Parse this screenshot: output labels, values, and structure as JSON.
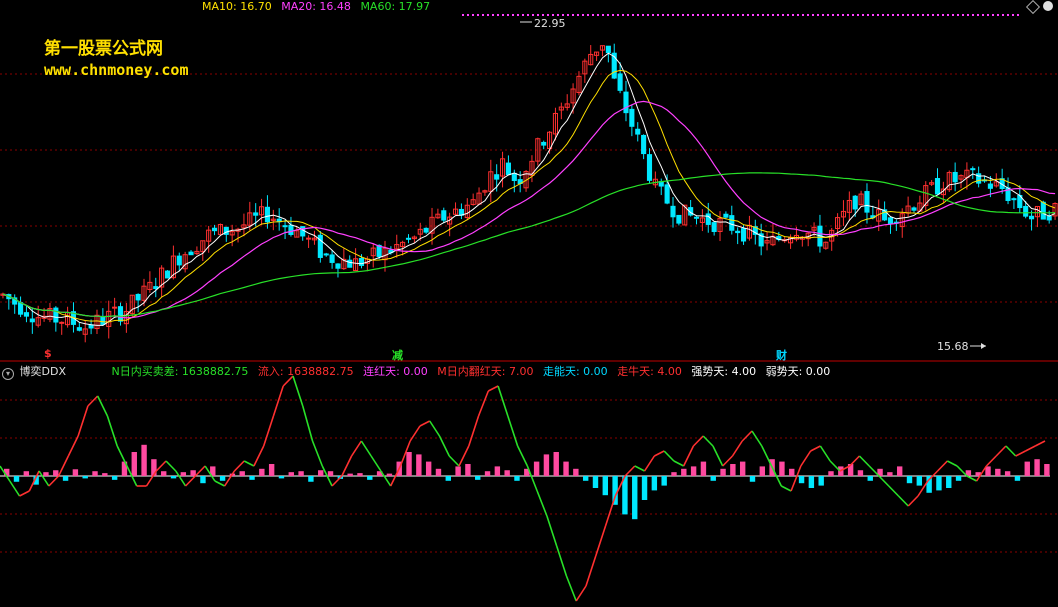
{
  "header": {
    "ma": [
      {
        "label": "MA10: 16.70",
        "color": "#ffe000"
      },
      {
        "label": "MA20: 16.48",
        "color": "#ff40ff"
      },
      {
        "label": "MA60: 17.97",
        "color": "#28e028"
      }
    ]
  },
  "watermark": {
    "line1": "第一股票公式网",
    "line2": "www.chnmoney.com"
  },
  "price_marks": {
    "high": "22.95",
    "low": "15.68"
  },
  "event_marks": [
    {
      "label": "$",
      "color": "#ff3030"
    },
    {
      "label": "减",
      "color": "#28e028"
    },
    {
      "label": "财",
      "color": "#00d8ff"
    }
  ],
  "indicator": {
    "name": "博奕DDX",
    "items": [
      {
        "label": "N日内买卖差: 1638882.75",
        "color": "#28e028"
      },
      {
        "label": "流入: 1638882.75",
        "color": "#ff3030"
      },
      {
        "label": "连红天: 0.00",
        "color": "#ff40ff"
      },
      {
        "label": "M日内翻红天: 7.00",
        "color": "#ff3030"
      },
      {
        "label": "走能天: 0.00",
        "color": "#00d8ff"
      },
      {
        "label": "走牛天: 4.00",
        "color": "#ff3030"
      },
      {
        "label": "强势天: 4.00",
        "color": "#ffffff"
      },
      {
        "label": "弱势天: 0.00",
        "color": "#ffffff"
      }
    ]
  },
  "colors": {
    "up": "#ff3030",
    "down": "#00e8ff",
    "ma10": "#ffffff",
    "ma5": "#ffe000",
    "ma20": "#ff40ff",
    "ma60": "#28e028",
    "grid": "#8a0000"
  },
  "chart_data": [
    {
      "type": "candlestick",
      "title": "",
      "n": 180,
      "anchors": [
        [
          0,
          15.3
        ],
        [
          12,
          14.7
        ],
        [
          22,
          14.6
        ],
        [
          28,
          14.4
        ],
        [
          36,
          14.7
        ],
        [
          42,
          14.9
        ],
        [
          50,
          15.5
        ],
        [
          60,
          16.4
        ],
        [
          70,
          17.0
        ],
        [
          80,
          17.2
        ],
        [
          90,
          17.6
        ],
        [
          100,
          17.1
        ],
        [
          110,
          16.4
        ],
        [
          120,
          16.2
        ],
        [
          130,
          16.5
        ],
        [
          140,
          16.9
        ],
        [
          150,
          17.5
        ],
        [
          160,
          17.9
        ],
        [
          165,
          18.6
        ],
        [
          170,
          19.0
        ],
        [
          175,
          18.5
        ],
        [
          180,
          19.2
        ],
        [
          190,
          20.5
        ],
        [
          200,
          22.1
        ],
        [
          205,
          22.5
        ],
        [
          208,
          21.3
        ],
        [
          215,
          19.9
        ],
        [
          222,
          18.3
        ],
        [
          230,
          17.6
        ],
        [
          240,
          17.4
        ],
        [
          250,
          17.2
        ],
        [
          260,
          16.7
        ],
        [
          270,
          17.2
        ],
        [
          280,
          16.8
        ],
        [
          290,
          18.0
        ],
        [
          300,
          17.4
        ],
        [
          310,
          17.9
        ],
        [
          320,
          18.5
        ],
        [
          330,
          18.6
        ],
        [
          340,
          18.3
        ],
        [
          350,
          17.5
        ],
        [
          360,
          17.8
        ]
      ],
      "ma_period_10": 10,
      "ma_period_20": 20,
      "ma_period_60": 60,
      "labels": {
        "high": "22.95",
        "low": "15.68"
      }
    },
    {
      "type": "bar+line",
      "title": "博奕DDX",
      "bars": [
        0.15,
        -0.12,
        0.1,
        -0.18,
        0.08,
        0.12,
        -0.1,
        0.14,
        -0.05,
        0.1,
        0.06,
        -0.08,
        0.3,
        0.5,
        0.65,
        0.35,
        0.1,
        -0.05,
        0.08,
        0.12,
        -0.15,
        0.2,
        -0.1,
        0.05,
        0.1,
        -0.08,
        0.15,
        0.25,
        -0.05,
        0.08,
        0.1,
        -0.12,
        0.12,
        0.1,
        -0.06,
        0.05,
        0.06,
        -0.08,
        0.1,
        0.05,
        0.3,
        0.5,
        0.45,
        0.3,
        0.15,
        -0.1,
        0.2,
        0.25,
        -0.08,
        0.1,
        0.2,
        0.12,
        -0.1,
        0.15,
        0.3,
        0.45,
        0.5,
        0.3,
        0.15,
        -0.1,
        -0.25,
        -0.4,
        -0.6,
        -0.8,
        -0.9,
        -0.5,
        -0.3,
        -0.2,
        0.08,
        0.15,
        0.2,
        0.3,
        -0.1,
        0.15,
        0.25,
        0.3,
        -0.12,
        0.2,
        0.35,
        0.3,
        0.15,
        -0.15,
        -0.25,
        -0.2,
        0.1,
        0.2,
        0.25,
        0.12,
        -0.1,
        0.15,
        0.08,
        0.2,
        -0.15,
        -0.2,
        -0.35,
        -0.3,
        -0.25,
        -0.1,
        0.12,
        0.08,
        0.2,
        0.15,
        0.1,
        -0.1,
        0.3,
        0.35,
        0.25
      ],
      "line": [
        0.1,
        -0.05,
        -0.2,
        -0.15,
        0.05,
        -0.1,
        0.0,
        0.2,
        0.4,
        0.7,
        0.8,
        0.6,
        0.3,
        0.1,
        -0.1,
        -0.1,
        0.05,
        0.15,
        0.05,
        -0.1,
        0.0,
        0.1,
        -0.05,
        -0.1,
        0.05,
        0.15,
        0.1,
        0.3,
        0.6,
        0.9,
        1.0,
        0.7,
        0.35,
        0.1,
        -0.1,
        0.0,
        0.2,
        0.35,
        0.2,
        0.05,
        -0.1,
        0.1,
        0.35,
        0.5,
        0.55,
        0.4,
        0.2,
        0.1,
        0.3,
        0.6,
        0.85,
        0.9,
        0.6,
        0.3,
        0.1,
        -0.15,
        -0.4,
        -0.7,
        -1.0,
        -1.25,
        -1.1,
        -0.8,
        -0.5,
        -0.2,
        0.0,
        0.1,
        0.05,
        0.2,
        0.25,
        0.15,
        0.1,
        0.3,
        0.4,
        0.3,
        0.1,
        0.2,
        0.35,
        0.45,
        0.3,
        0.1,
        -0.1,
        -0.15,
        0.1,
        0.25,
        0.3,
        0.15,
        0.05,
        0.1,
        0.2,
        0.1,
        0.0,
        -0.1,
        -0.2,
        -0.3,
        -0.2,
        -0.05,
        0.05,
        0.15,
        0.1,
        0.0,
        -0.05,
        0.1,
        0.2,
        0.3,
        0.2,
        0.25,
        0.3,
        0.35
      ]
    }
  ]
}
